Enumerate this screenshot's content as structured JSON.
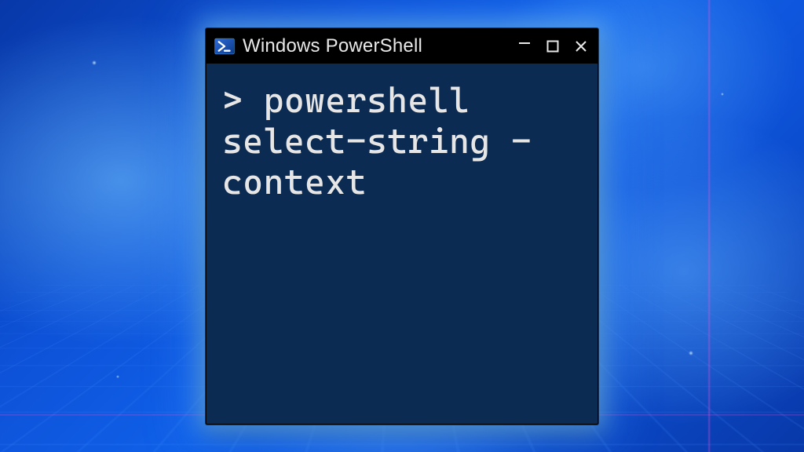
{
  "window": {
    "title": "Windows PowerShell",
    "icon": "powershell-icon"
  },
  "terminal": {
    "prompt": "> ",
    "command": "powershell select-string -context"
  },
  "colors": {
    "terminal_bg": "#0c2b52",
    "titlebar_bg": "#000000",
    "text": "#e6e6e6"
  }
}
